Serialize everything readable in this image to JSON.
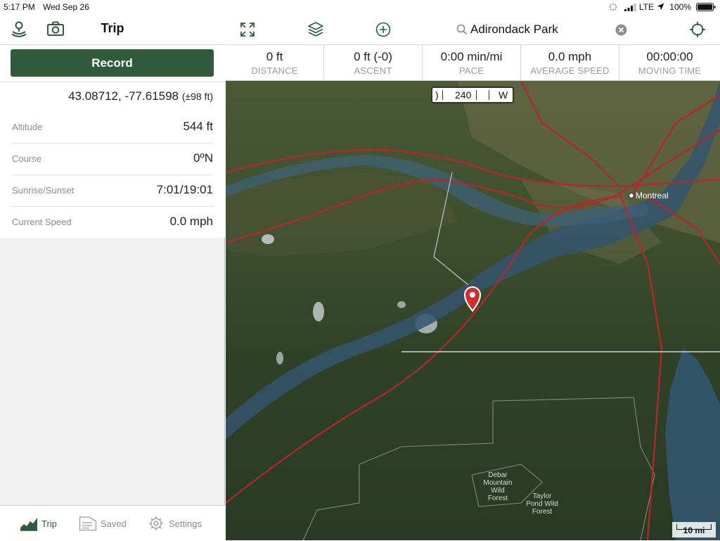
{
  "status": {
    "time": "5:17 PM",
    "date": "Wed Sep 26",
    "network": "LTE",
    "battery": "100%"
  },
  "left_header": {
    "title": "Trip",
    "icons": [
      "gps-pin-icon",
      "camera-icon"
    ]
  },
  "record": {
    "label": "Record"
  },
  "location": {
    "coords": "43.08712, -77.61598",
    "accuracy": "(±98 ft)"
  },
  "info_rows": [
    {
      "label": "Altitude",
      "value": "544 ft"
    },
    {
      "label": "Course",
      "value": "0ºN"
    },
    {
      "label": "Sunrise/Sunset",
      "value": "7:01/19:01"
    },
    {
      "label": "Current Speed",
      "value": "0.0 mph"
    }
  ],
  "tabs": [
    {
      "label": "Trip",
      "icon": "trip-chart-icon",
      "active": true
    },
    {
      "label": "Saved",
      "icon": "saved-list-icon",
      "active": false
    },
    {
      "label": "Settings",
      "icon": "gear-icon",
      "active": false
    }
  ],
  "toolbar": {
    "icons": [
      "expand-icon",
      "layers-icon",
      "add-icon",
      "locate-icon"
    ],
    "search_value": "Adirondack Park"
  },
  "stats": [
    {
      "value": "0 ft",
      "label": "DISTANCE"
    },
    {
      "value": "0 ft (-0)",
      "label": "ASCENT"
    },
    {
      "value": "0:00 min/mi",
      "label": "PACE"
    },
    {
      "value": "0.0 mph",
      "label": "AVERAGE SPEED"
    },
    {
      "value": "00:00:00",
      "label": "MOVING TIME"
    }
  ],
  "map": {
    "compass_value": "240",
    "compass_dir": "W",
    "compass_left_mark": ")",
    "labels": {
      "city": "Montreal",
      "forest1_line1": "Debar",
      "forest1_line2": "Mountain",
      "forest1_line3": "Wild",
      "forest1_line4": "Forest",
      "forest2_line1": "Taylor",
      "forest2_line2": "Pond Wild",
      "forest2_line3": "Forest"
    },
    "scale": "10 mi",
    "colors": {
      "accent": "#2f5a3c",
      "marker": "#d0302b",
      "road": "#b3282d",
      "water": "#34556e"
    }
  }
}
